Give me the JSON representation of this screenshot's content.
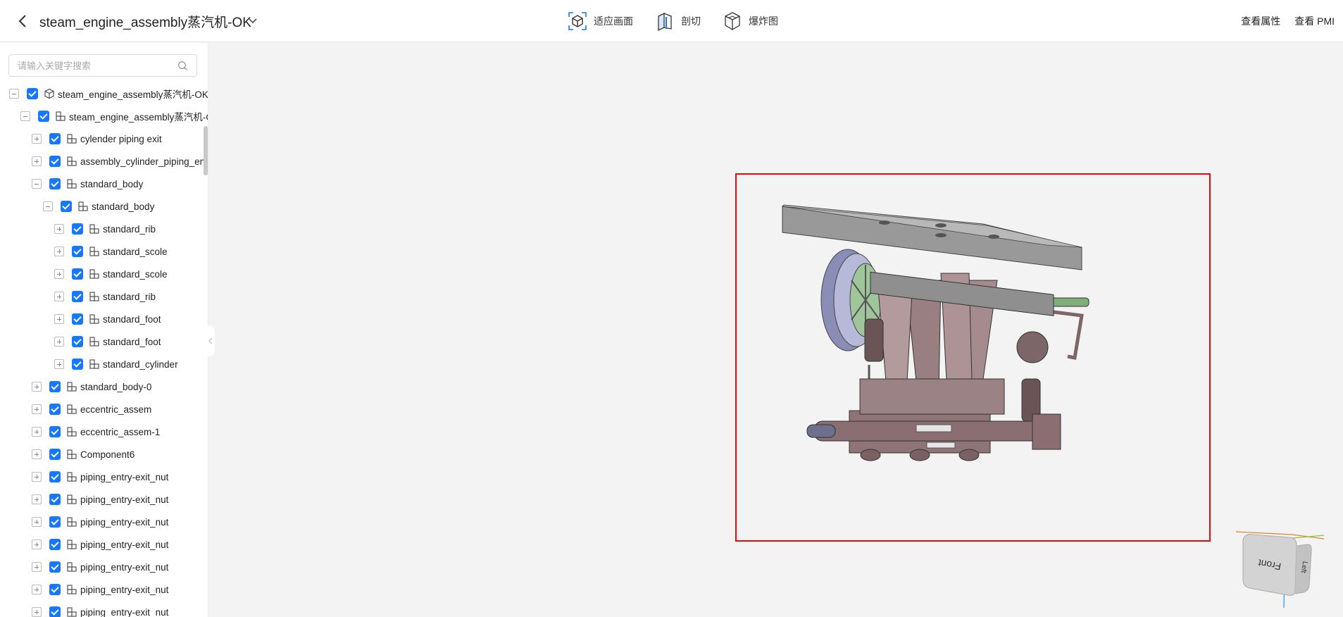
{
  "header": {
    "title": "steam_engine_assembly蒸汽机-OK",
    "tools": [
      {
        "icon": "fit-view-icon",
        "label": "适应画面"
      },
      {
        "icon": "section-cut-icon",
        "label": "剖切"
      },
      {
        "icon": "explode-view-icon",
        "label": "爆炸图"
      }
    ],
    "links": [
      "查看属性",
      "查看 PMI"
    ]
  },
  "sidebar": {
    "search_placeholder": "请输入关键字搜索",
    "tree": [
      {
        "label": "steam_engine_assembly蒸汽机-OK",
        "depth": 0,
        "state": "expanded",
        "icon": "part-cube-icon"
      },
      {
        "label": "steam_engine_assembly蒸汽机-OK",
        "depth": 1,
        "state": "expanded",
        "icon": "assembly-icon"
      },
      {
        "label": "cylender piping exit",
        "depth": 2,
        "state": "collapsed",
        "icon": "assembly-icon"
      },
      {
        "label": "assembly_cylinder_piping_entry",
        "depth": 2,
        "state": "collapsed",
        "icon": "assembly-icon"
      },
      {
        "label": "standard_body",
        "depth": 2,
        "state": "expanded",
        "icon": "assembly-icon"
      },
      {
        "label": "standard_body",
        "depth": 3,
        "state": "expanded",
        "icon": "assembly-icon"
      },
      {
        "label": "standard_rib",
        "depth": 4,
        "state": "collapsed",
        "icon": "assembly-icon"
      },
      {
        "label": "standard_scole",
        "depth": 4,
        "state": "collapsed",
        "icon": "assembly-icon"
      },
      {
        "label": "standard_scole",
        "depth": 4,
        "state": "collapsed",
        "icon": "assembly-icon"
      },
      {
        "label": "standard_rib",
        "depth": 4,
        "state": "collapsed",
        "icon": "assembly-icon"
      },
      {
        "label": "standard_foot",
        "depth": 4,
        "state": "collapsed",
        "icon": "assembly-icon"
      },
      {
        "label": "standard_foot",
        "depth": 4,
        "state": "collapsed",
        "icon": "assembly-icon"
      },
      {
        "label": "standard_cylinder",
        "depth": 4,
        "state": "collapsed",
        "icon": "assembly-icon"
      },
      {
        "label": "standard_body-0",
        "depth": 2,
        "state": "collapsed",
        "icon": "assembly-icon"
      },
      {
        "label": "eccentric_assem",
        "depth": 2,
        "state": "collapsed",
        "icon": "assembly-icon"
      },
      {
        "label": "eccentric_assem-1",
        "depth": 2,
        "state": "collapsed",
        "icon": "assembly-icon"
      },
      {
        "label": "Component6",
        "depth": 2,
        "state": "collapsed",
        "icon": "assembly-icon"
      },
      {
        "label": "piping_entry-exit_nut",
        "depth": 2,
        "state": "collapsed",
        "icon": "assembly-icon"
      },
      {
        "label": "piping_entry-exit_nut",
        "depth": 2,
        "state": "collapsed",
        "icon": "assembly-icon"
      },
      {
        "label": "piping_entry-exit_nut",
        "depth": 2,
        "state": "collapsed",
        "icon": "assembly-icon"
      },
      {
        "label": "piping_entry-exit_nut",
        "depth": 2,
        "state": "collapsed",
        "icon": "assembly-icon"
      },
      {
        "label": "piping_entry-exit_nut",
        "depth": 2,
        "state": "collapsed",
        "icon": "assembly-icon"
      },
      {
        "label": "piping_entry-exit_nut",
        "depth": 2,
        "state": "collapsed",
        "icon": "assembly-icon"
      },
      {
        "label": "piping_entry-exit_nut",
        "depth": 2,
        "state": "collapsed",
        "icon": "assembly-icon"
      }
    ]
  },
  "viewport": {
    "highlight_color": "#e30a0a",
    "view_cube": {
      "front_label": "Front",
      "left_label": "Left"
    }
  },
  "colors": {
    "accent": "#1677ff",
    "highlight": "#e30a0a"
  }
}
